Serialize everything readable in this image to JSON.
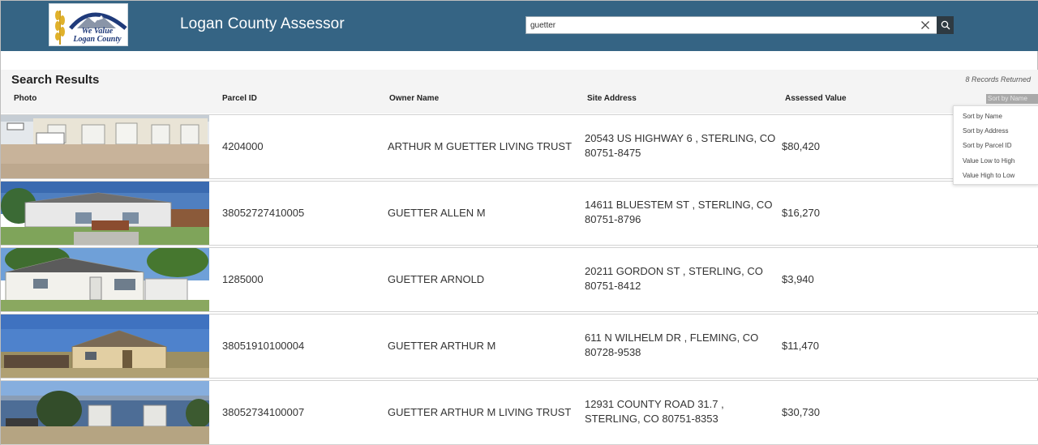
{
  "header": {
    "logo": {
      "line1": "We Value",
      "line2": "Logan County"
    },
    "title": "Logan County Assessor",
    "search": {
      "value": "guetter",
      "placeholder": ""
    },
    "colors": {
      "bar": "#356484",
      "search_button": "#2e3a42"
    }
  },
  "results": {
    "title": "Search Results",
    "records": "8 Records Returned",
    "columns": {
      "photo": "Photo",
      "parcel": "Parcel ID",
      "owner": "Owner Name",
      "address": "Site Address",
      "value": "Assessed Value"
    },
    "sort": {
      "current": "Sort by Name",
      "options": [
        "Sort by Name",
        "Sort by Address",
        "Sort by Parcel ID",
        "Value Low to High",
        "Value High to Low"
      ]
    },
    "rows": [
      {
        "parcel": "4204000",
        "owner": "ARTHUR M GUETTER LIVING TRUST",
        "address": "20543 US HIGHWAY 6 , STERLING, CO  80751-8475",
        "value": "$80,420"
      },
      {
        "parcel": "38052727410005",
        "owner": "GUETTER ALLEN M",
        "address": "14611 BLUESTEM ST , STERLING, CO 80751-8796",
        "value": "$16,270"
      },
      {
        "parcel": "1285000",
        "owner": "GUETTER ARNOLD",
        "address": "20211 GORDON ST , STERLING, CO 80751-8412",
        "value": "$3,940"
      },
      {
        "parcel": "38051910100004",
        "owner": "GUETTER ARTHUR M",
        "address": "611 N WILHELM DR , FLEMING, CO 80728-9538",
        "value": "$11,470"
      },
      {
        "parcel": "38052734100007",
        "owner": "GUETTER ARTHUR M LIVING TRUST",
        "address": "12931 COUNTY ROAD 31.7 , STERLING, CO  80751-8353",
        "value": "$30,730"
      }
    ]
  }
}
